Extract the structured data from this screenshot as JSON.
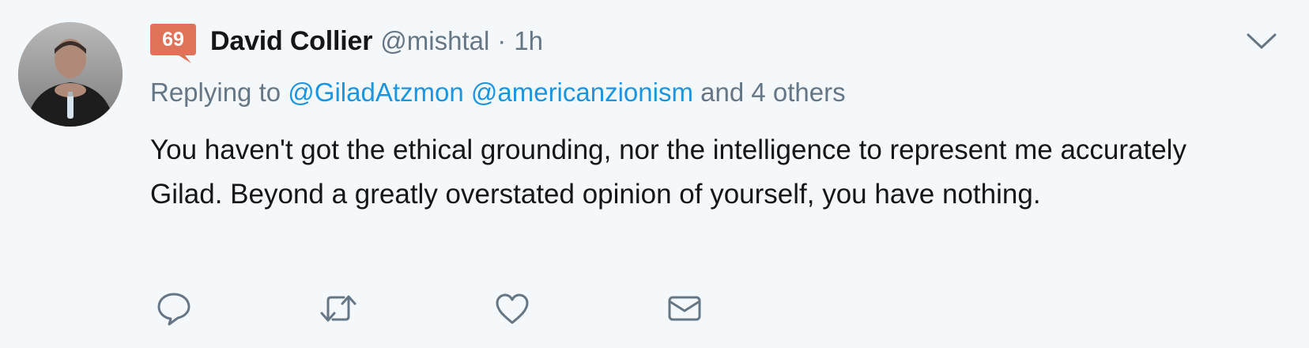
{
  "tweet": {
    "badge_count": "69",
    "display_name": "David Collier",
    "handle": "@mishtal",
    "separator": "·",
    "time": "1h",
    "reply": {
      "prefix": "Replying to",
      "mentions": [
        "@GiladAtzmon",
        "@americanzionism"
      ],
      "suffix": "and 4 others"
    },
    "text": "You haven't got the ethical grounding, nor the intelligence to represent me accurately Gilad. Beyond a greatly overstated opinion of yourself, you have nothing."
  },
  "icons": {
    "reply": "reply-icon",
    "retweet": "retweet-icon",
    "like": "heart-icon",
    "dm": "envelope-icon",
    "more": "chevron-down-icon"
  },
  "colors": {
    "background": "#f5f8fa",
    "text": "#14171a",
    "muted": "#657786",
    "link": "#1b95e0",
    "badge": "#e0725a"
  }
}
